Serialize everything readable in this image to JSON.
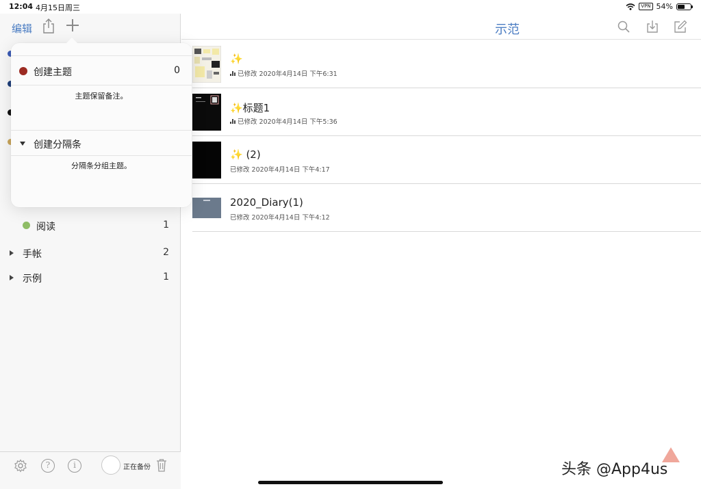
{
  "status_bar": {
    "time": "12:04",
    "date": "4月15日周三",
    "vpn": "VPN",
    "battery": "54%",
    "battery_level": 0.54
  },
  "sidebar": {
    "edit_label": "编辑",
    "dot_colors": [
      "#3b5bb5",
      "#1f3f7a",
      "#111111",
      "#c9a55a"
    ],
    "items": [
      {
        "label": "阅读",
        "count": "1",
        "color": "#8fbd66"
      },
      {
        "label": "手帐",
        "count": "2"
      },
      {
        "label": "示例",
        "count": "1"
      }
    ],
    "backup_status": "正在备份"
  },
  "popover": {
    "create_topic": {
      "label": "创建主题",
      "count": "0",
      "description": "主题保留备注。",
      "color": "#9c2b22"
    },
    "create_divider": {
      "label": "创建分隔条",
      "description": "分隔条分组主题。"
    }
  },
  "main": {
    "title": "示范",
    "notes": [
      {
        "title": "✨",
        "meta": "已修改 2020年4月14日 下午6:31",
        "has_audio": true
      },
      {
        "title": "✨标题1",
        "meta": "已修改 2020年4月14日 下午5:36",
        "has_audio": true
      },
      {
        "title": "✨ (2)",
        "meta": "已修改 2020年4月14日 下午4:17",
        "has_audio": false
      },
      {
        "title": "2020_Diary(1)",
        "meta": "已修改 2020年4月14日 下午4:12",
        "has_audio": false
      }
    ]
  },
  "watermark": "头条 @App4us",
  "colors": {
    "accent": "#4a7cc2"
  }
}
